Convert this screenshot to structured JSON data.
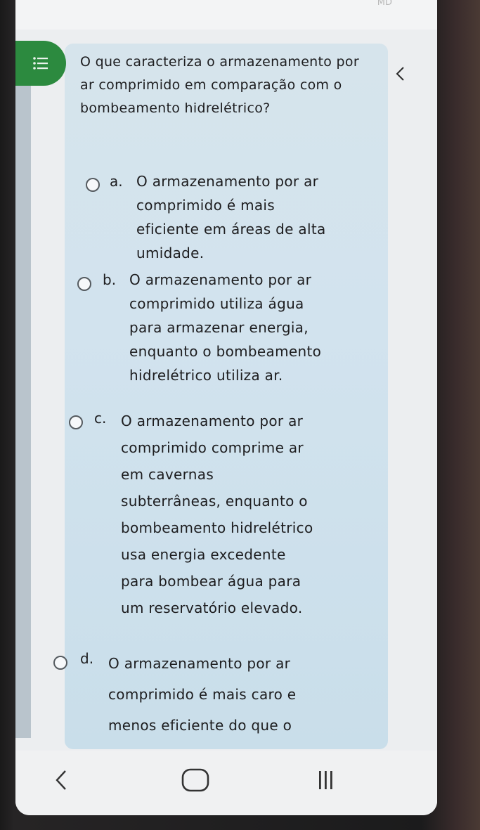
{
  "status": {
    "indicator": "MD"
  },
  "question": {
    "text": "O que caracteriza o armazenamento por ar comprimido em comparação com o bombeamento hidrelétrico?"
  },
  "options": [
    {
      "letter": "a.",
      "lines": [
        "O armazenamento por ar",
        "comprimido é mais",
        "eficiente em áreas de alta",
        "umidade."
      ],
      "selected": false
    },
    {
      "letter": "b.",
      "lines": [
        "O armazenamento por ar",
        "comprimido utiliza água",
        "para armazenar energia,",
        "enquanto o bombeamento",
        "hidrelétrico utiliza ar."
      ],
      "selected": false
    },
    {
      "letter": "c.",
      "lines": [
        "O armazenamento por ar",
        "comprimido comprime ar",
        "em cavernas",
        "subterrâneas, enquanto o",
        "bombeamento hidrelétrico",
        "usa energia excedente",
        "para bombear água para",
        "um reservatório elevado."
      ],
      "selected": false
    },
    {
      "letter": "d.",
      "lines": [
        "O armazenamento por ar",
        "comprimido é mais caro e",
        "menos eficiente do que o"
      ],
      "selected": false
    }
  ],
  "icons": {
    "index": "list-icon",
    "back": "chevron-left-icon",
    "nav_back": "nav-back-icon",
    "nav_home": "nav-home-icon",
    "nav_recent": "nav-recent-apps-icon"
  },
  "colors": {
    "accent_green": "#2c8a3f",
    "card_bg": "#d2e3ee",
    "text": "#1d1d1f"
  }
}
